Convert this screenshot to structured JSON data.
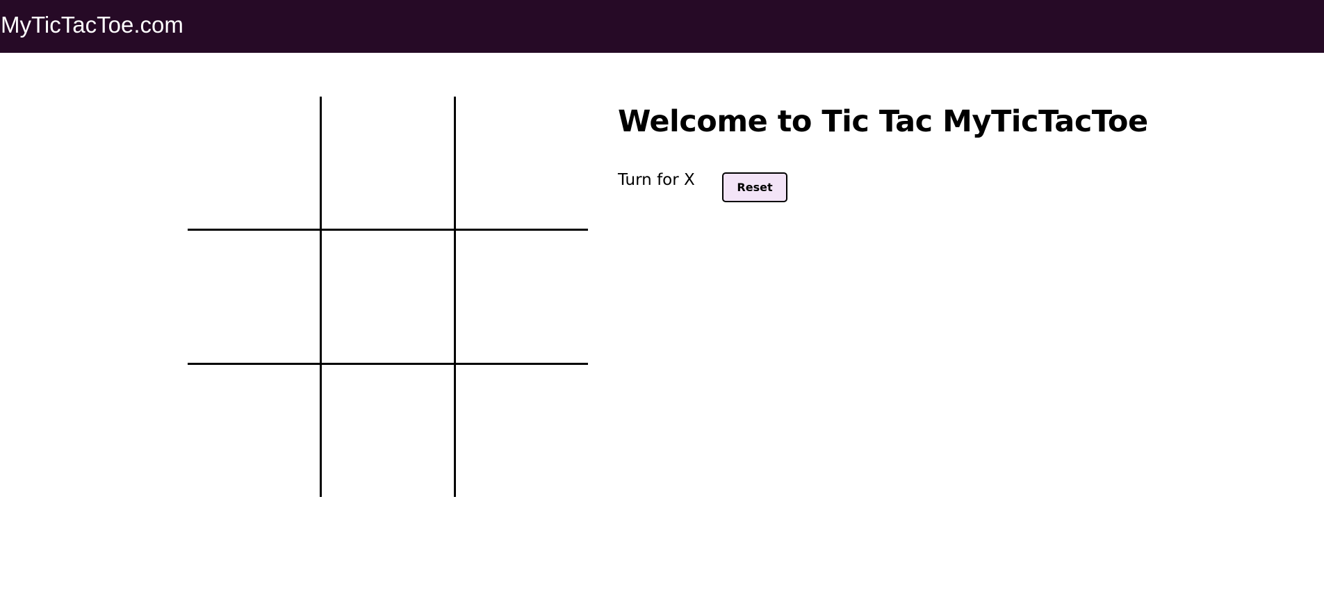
{
  "navbar": {
    "brand": "MyTicTacToe.com",
    "background": "#260a26"
  },
  "board": {
    "cells": [
      "",
      "",
      "",
      "",
      "",
      "",
      "",
      "",
      ""
    ]
  },
  "main": {
    "title": "Welcome to Tic Tac MyTicTacToe",
    "turn_text": "Turn for X",
    "reset_label": "Reset",
    "reset_color": "#f3e4f7"
  }
}
